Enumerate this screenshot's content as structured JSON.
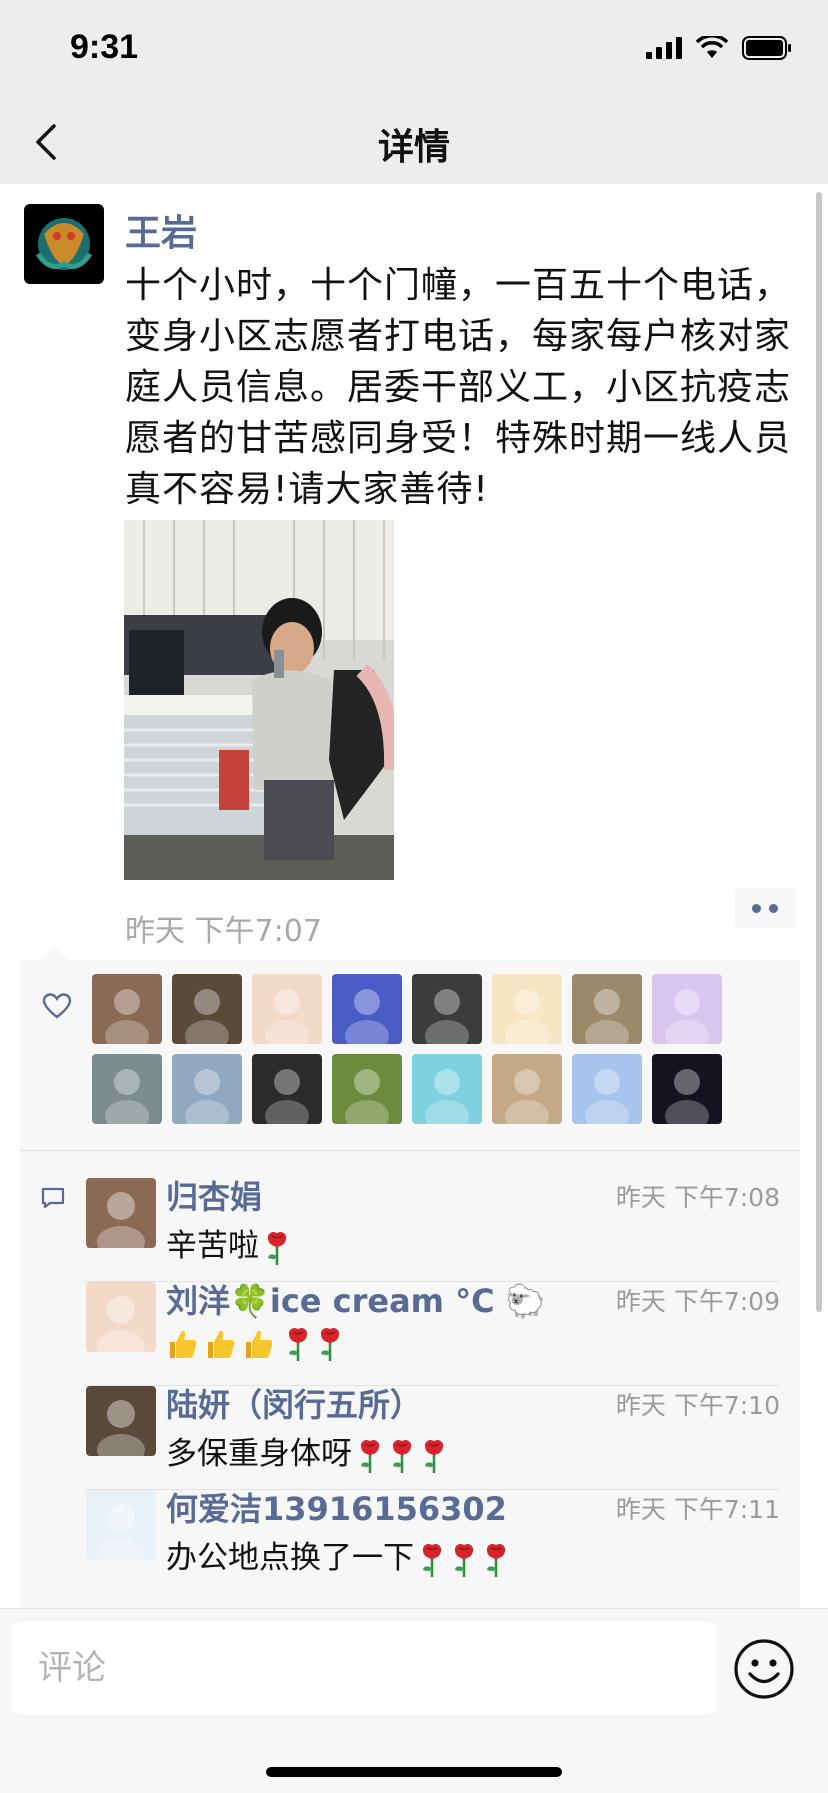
{
  "status": {
    "time": "9:31"
  },
  "nav": {
    "title": "详情"
  },
  "post": {
    "author": "王岩",
    "text": "十个小时，十个门幢，一百五十个电话，变身小区志愿者打电话，每家每户核对家庭人员信息。居委干部义工，小区抗疫志愿者的甘苦感同身受！特殊时期一线人员真不容易!请大家善待!",
    "time": "昨天 下午7:07"
  },
  "likes": {
    "icon": "heart-outline-icon",
    "avatars": [
      {
        "color": "#8b6a55"
      },
      {
        "color": "#5a4a3a"
      },
      {
        "color": "#f2d9c8"
      },
      {
        "color": "#4a5cc6"
      },
      {
        "color": "#3c3c3c"
      },
      {
        "color": "#f6e6c4"
      },
      {
        "color": "#9a8a6a"
      },
      {
        "color": "#d9c6f0"
      },
      {
        "color": "#7f8c8d"
      },
      {
        "color": "#90a8c0"
      },
      {
        "color": "#2b2b2b"
      },
      {
        "color": "#6f8a3c"
      },
      {
        "color": "#7fd1e0"
      },
      {
        "color": "#c4a888"
      },
      {
        "color": "#a7c4ec"
      },
      {
        "color": "#141420"
      }
    ]
  },
  "comments": [
    {
      "name": "归杏娟",
      "time": "昨天 下午7:08",
      "text": "辛苦啦",
      "emoji": "rose",
      "emoji_count": 1,
      "avatar_color": "#8b6a55"
    },
    {
      "name": "刘洋🍀ice cream °C 🐑",
      "time": "昨天 下午7:09",
      "text": "👍👍👍",
      "emoji": "rose",
      "emoji_count": 2,
      "avatar_color": "#f2d9c8"
    },
    {
      "name": "陆妍（闵行五所）",
      "time": "昨天 下午7:10",
      "text": "多保重身体呀",
      "emoji": "rose",
      "emoji_count": 3,
      "avatar_color": "#5a4a3a"
    },
    {
      "name": "何爱洁13916156302",
      "time": "昨天 下午7:11",
      "text": "办公地点换了一下",
      "emoji": "rose",
      "emoji_count": 3,
      "avatar_color": "#e8f0f8"
    }
  ],
  "input": {
    "placeholder": "评论"
  },
  "colors": {
    "link": "#576b95",
    "panel": "#f7f7f7",
    "nav": "#ededed"
  }
}
